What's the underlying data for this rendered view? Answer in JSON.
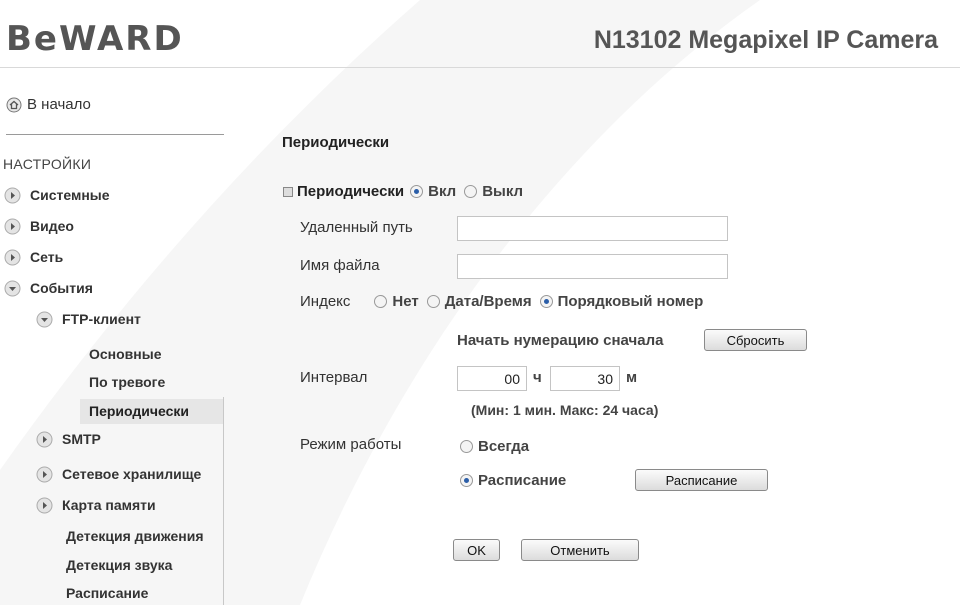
{
  "header": {
    "logo": "BeWARD",
    "camera_title": "N13102 Megapixel IP Camera"
  },
  "sidebar": {
    "home_label": "В начало",
    "settings_title": "НАСТРОЙКИ",
    "items": {
      "system": "Системные",
      "video": "Видео",
      "network": "Сеть",
      "events": "События",
      "ftp_client": "FTP-клиент",
      "basic": "Основные",
      "on_alarm": "По тревоге",
      "periodic": "Периодически",
      "smtp": "SMTP",
      "network_storage": "Сетевое хранилище",
      "memory_card": "Карта памяти",
      "motion_detection": "Детекция движения",
      "sound_detection": "Детекция звука",
      "schedule": "Расписание"
    }
  },
  "main": {
    "section_title": "Периодически",
    "periodic_label": "Периодически",
    "on_label": "Вкл",
    "off_label": "Выкл",
    "periodic_enabled": true,
    "remote_path_label": "Удаленный путь",
    "remote_path_value": "",
    "filename_label": "Имя файла",
    "filename_value": "",
    "index_label": "Индекс",
    "index_options": [
      "Нет",
      "Дата/Время",
      "Порядковый номер"
    ],
    "index_selected": "Порядковый номер",
    "restart_numbering_label": "Начать нумерацию сначала",
    "reset_button": "Сбросить",
    "interval_label": "Интервал",
    "interval_hours": "00",
    "hours_unit": "ч",
    "interval_minutes": "30",
    "minutes_unit": "м",
    "interval_hint": "(Мин: 1 мин. Макс: 24 часа)",
    "mode_label": "Режим работы",
    "mode_always": "Всегда",
    "mode_schedule": "Расписание",
    "mode_selected": "Расписание",
    "schedule_button": "Расписание",
    "ok_button": "OK",
    "cancel_button": "Отменить"
  }
}
